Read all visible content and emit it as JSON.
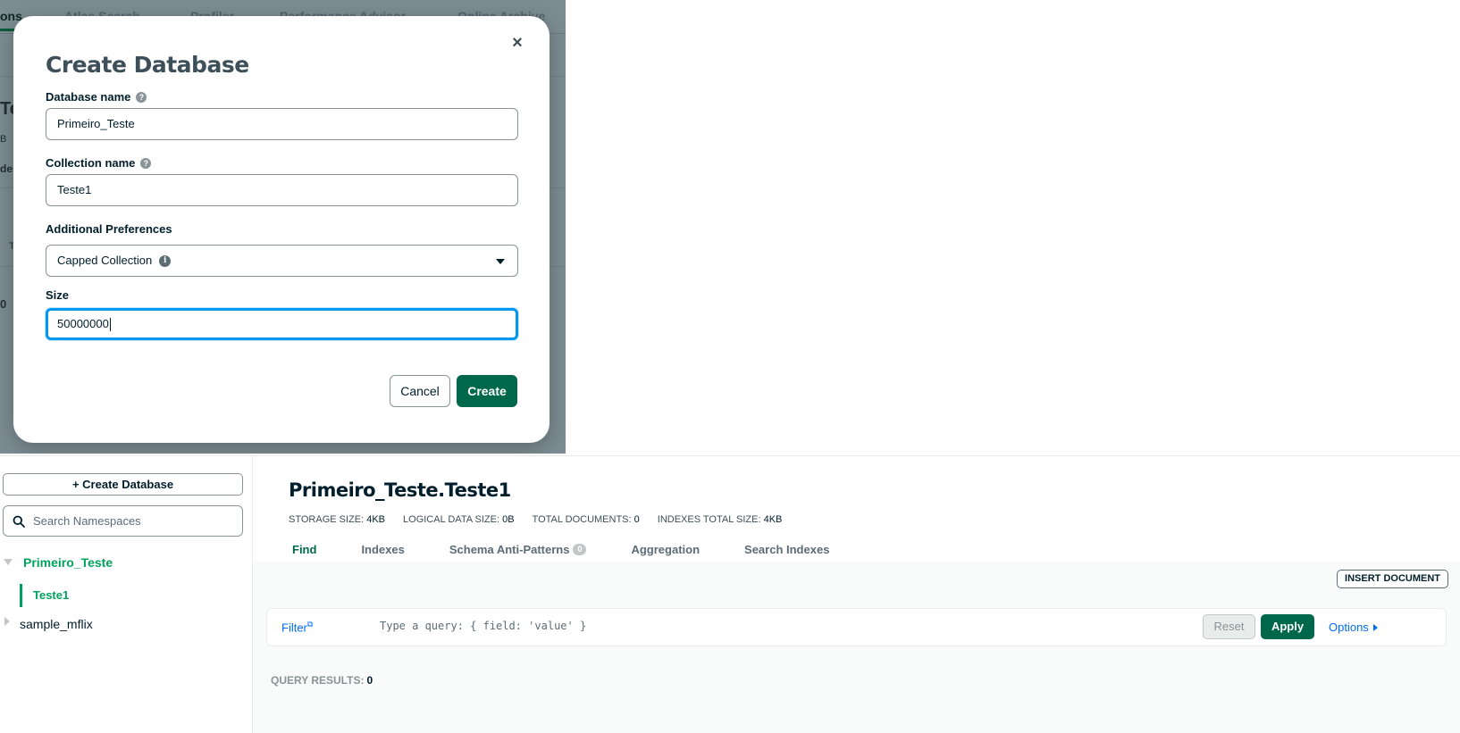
{
  "background_tabs": [
    {
      "label": "ons",
      "active": true
    },
    {
      "label": "Atlas Search"
    },
    {
      "label": "Profiler"
    },
    {
      "label": "Performance Advisor"
    },
    {
      "label": "Online Archive"
    }
  ],
  "background_fragments": {
    "title": "Te",
    "size": "B",
    "indexes": "des",
    "col": "T",
    "count": "0"
  },
  "modal": {
    "title": "Create Database",
    "close_icon": "×",
    "database_name_label": "Database name",
    "database_name_value": "Primeiro_Teste",
    "collection_name_label": "Collection name",
    "collection_name_value": "Teste1",
    "additional_preferences_label": "Additional Preferences",
    "preference_selected": "Capped Collection",
    "size_label": "Size",
    "size_value": "50000000",
    "cancel_label": "Cancel",
    "create_label": "Create"
  },
  "sidebar": {
    "create_database_label": "+ Create Database",
    "search_placeholder": "Search Namespaces",
    "databases": [
      {
        "name": "Primeiro_Teste",
        "expanded": true,
        "collections": [
          {
            "name": "Teste1",
            "active": true
          }
        ]
      },
      {
        "name": "sample_mflix",
        "expanded": false
      }
    ]
  },
  "main": {
    "namespace": "Primeiro_Teste.Teste1",
    "stats": [
      {
        "key": "STORAGE SIZE:",
        "value": "4KB"
      },
      {
        "key": "LOGICAL DATA SIZE:",
        "value": "0B"
      },
      {
        "key": "TOTAL DOCUMENTS:",
        "value": "0"
      },
      {
        "key": "INDEXES TOTAL SIZE:",
        "value": "4KB"
      }
    ],
    "tabs": [
      {
        "label": "Find",
        "active": true
      },
      {
        "label": "Indexes"
      },
      {
        "label": "Schema Anti-Patterns",
        "badge": "0"
      },
      {
        "label": "Aggregation"
      },
      {
        "label": "Search Indexes"
      }
    ],
    "insert_document_label": "INSERT DOCUMENT",
    "filter_label": "Filter",
    "query_placeholder": "Type a query: { field: 'value' }",
    "reset_label": "Reset",
    "apply_label": "Apply",
    "options_label": "Options",
    "query_results_label": "QUERY RESULTS:",
    "query_results_count": "0"
  },
  "colors": {
    "accent_green": "#00684a",
    "tree_green": "#00a35c",
    "link_blue": "#016bf8",
    "focus_blue": "#0498ec",
    "overlay": "#7c8c92"
  }
}
